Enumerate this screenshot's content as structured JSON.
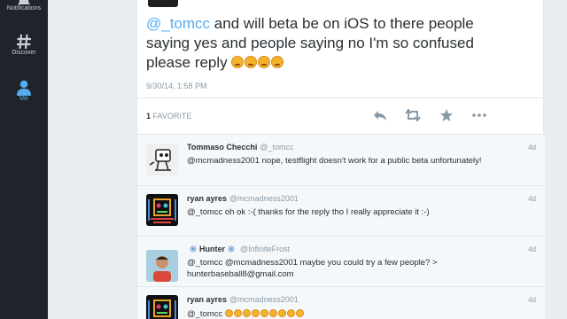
{
  "sidebar": {
    "items": [
      {
        "label": "Notifications",
        "icon": "bell-icon",
        "active": false
      },
      {
        "label": "Discover",
        "icon": "hashtag-icon",
        "active": false
      },
      {
        "label": "Me",
        "icon": "person-icon",
        "active": true
      }
    ]
  },
  "tweet": {
    "mention": "@_tomcc",
    "text": " and will beta be on iOS to there people saying yes and people saying no I'm so confused please reply ",
    "emoji_count": 4,
    "timestamp": "9/30/14, 1:58 PM",
    "favorites_count": "1",
    "favorites_label": "FAVORITE",
    "actions": [
      "reply-icon",
      "retweet-icon",
      "favorite-star-icon",
      "more-icon"
    ]
  },
  "replies": [
    {
      "name": "Tommaso Checchi",
      "handle": "@_tomcc",
      "time": "4d",
      "text": "@mcmadness2001 nope, testflight doesn't work for a public beta unfortunately!"
    },
    {
      "name": "ryan ayres",
      "handle": "@mcmadness2001",
      "time": "4d",
      "text": "@_tomcc oh ok :-( thanks for the reply tho I really appreciate it :-)"
    },
    {
      "name": "Hunter",
      "handle": "@InfiniteFrost",
      "time": "4d",
      "text": "@_tomcc @mcmadness2001 maybe you could try a few people? > hunterbaseball8@gmail.com"
    },
    {
      "name": "ryan ayres",
      "handle": "@mcmadness2001",
      "time": "4d",
      "text": "@_tomcc",
      "emoji_count": 9
    }
  ],
  "colors": {
    "sidebar_bg": "#1e2429",
    "accent": "#55acee",
    "text": "#292f33",
    "muted": "#8899a6"
  }
}
